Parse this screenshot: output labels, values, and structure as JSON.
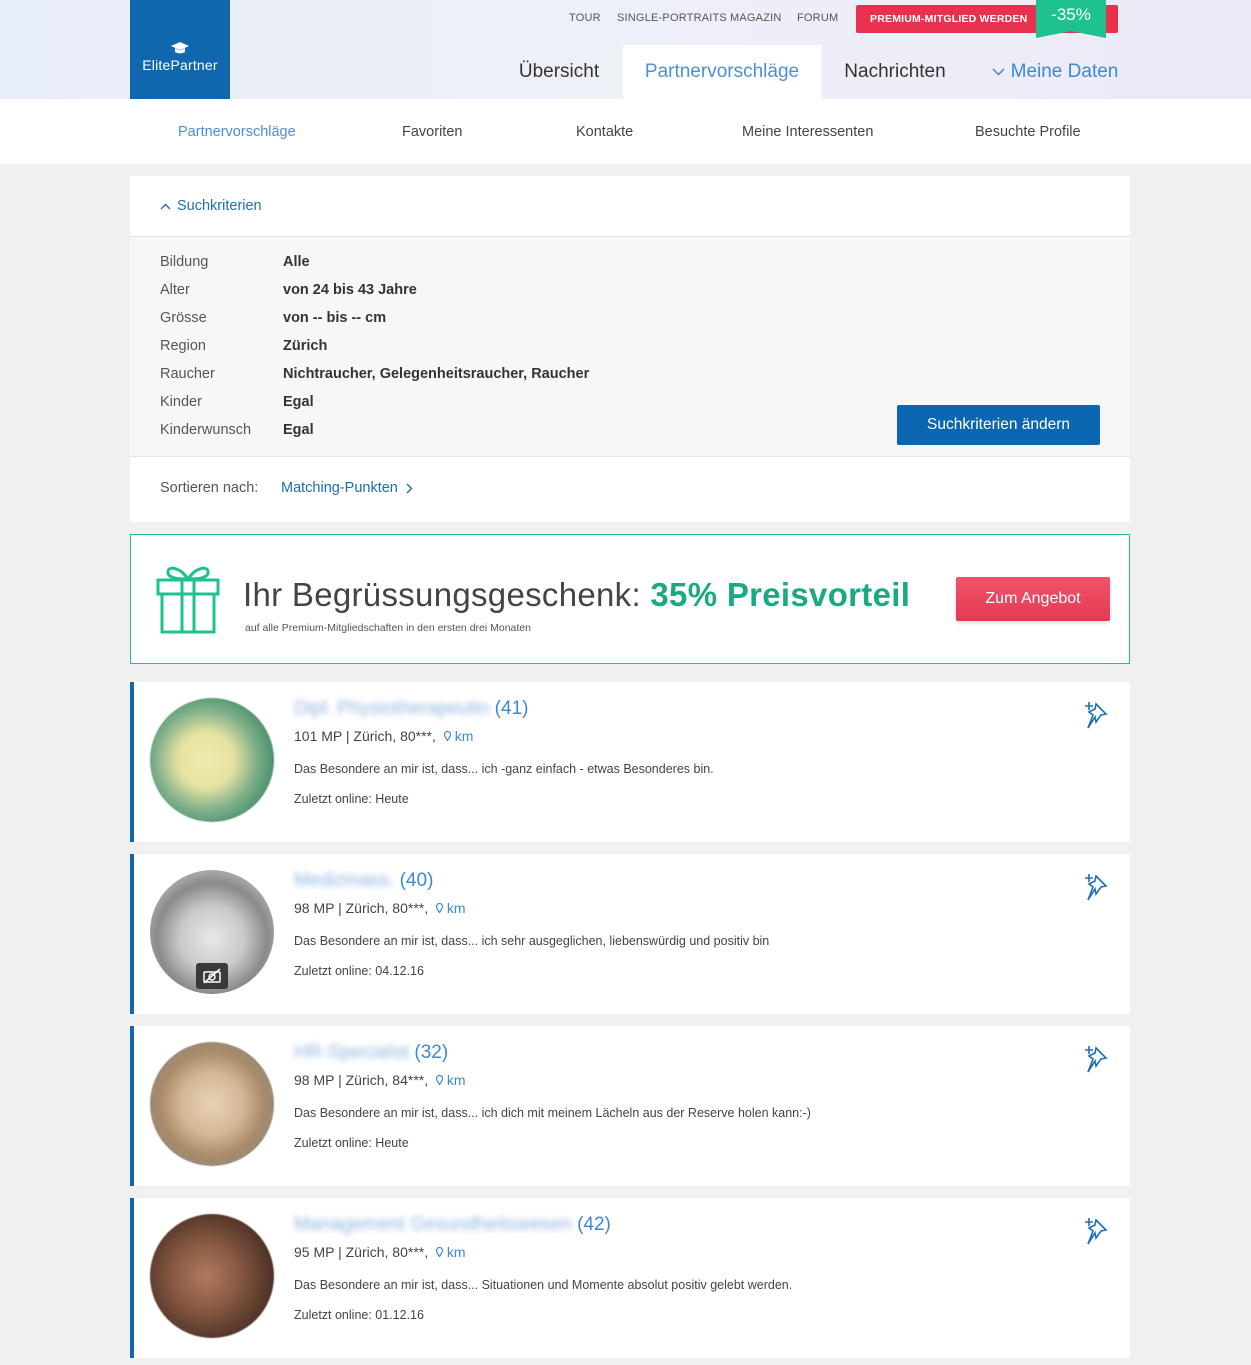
{
  "brand": {
    "name": "ElitePartner"
  },
  "topnav": {
    "tour": "TOUR",
    "portraits": "SINGLE-PORTRAITS",
    "magazin": "MAGAZIN",
    "forum": "FORUM"
  },
  "premium": {
    "label": "PREMIUM-MITGLIED WERDEN",
    "discount": "-35%"
  },
  "mainnav": {
    "uebersicht": "Übersicht",
    "partnervorschlaege": "Partnervorschläge",
    "nachrichten": "Nachrichten",
    "meine_daten": "Meine Daten"
  },
  "subnav": {
    "partnervorschlaege": "Partnervorschläge",
    "favoriten": "Favoriten",
    "kontakte": "Kontakte",
    "interessenten": "Meine Interessenten",
    "besuchte": "Besuchte Profile"
  },
  "criteria": {
    "toggle_label": "Suchkriterien",
    "rows": [
      {
        "label": "Bildung",
        "value": "Alle"
      },
      {
        "label": "Alter",
        "value": "von 24 bis 43 Jahre"
      },
      {
        "label": "Grösse",
        "value": "von -- bis -- cm"
      },
      {
        "label": "Region",
        "value": "Zürich"
      },
      {
        "label": "Raucher",
        "value": "Nichtraucher, Gelegenheitsraucher, Raucher"
      },
      {
        "label": "Kinder",
        "value": "Egal"
      },
      {
        "label": "Kinderwunsch",
        "value": "Egal"
      }
    ],
    "change_button": "Suchkriterien ändern",
    "sort_label": "Sortieren nach:",
    "sort_value": "Matching-Punkten"
  },
  "promo": {
    "title": "Ihr Begrüssungsgeschenk:",
    "highlight": "35% Preisvorteil",
    "subtitle": "auf alle Premium-Mitgliedschaften in den ersten drei Monaten",
    "button": "Zum Angebot"
  },
  "profiles": [
    {
      "title": "Dipl. Physiotherapeutin",
      "age": "(41)",
      "mp": "101 MP | Zürich, 80***,",
      "km": "km",
      "desc": "Das Besondere an mir ist, dass... ich -ganz einfach - etwas Besonderes bin.",
      "online": "Zuletzt online: Heute"
    },
    {
      "title": "Medizinass.",
      "age": "(40)",
      "mp": "98 MP | Zürich, 80***,",
      "km": "km",
      "desc": "Das Besondere an mir ist, dass... ich sehr ausgeglichen, liebenswürdig und positiv bin",
      "online": "Zuletzt online: 04.12.16"
    },
    {
      "title": "HR-Specialist",
      "age": "(32)",
      "mp": "98 MP | Zürich, 84***,",
      "km": "km",
      "desc": "Das Besondere an mir ist, dass... ich dich mit meinem Lächeln aus der Reserve holen kann:-)",
      "online": "Zuletzt online: Heute"
    },
    {
      "title": "Management Gesundheitswesen",
      "age": "(42)",
      "mp": "95 MP | Zürich, 80***,",
      "km": "km",
      "desc": "Das Besondere an mir ist, dass... Situationen und Momente absolut positiv gelebt werden.",
      "online": "Zuletzt online: 01.12.16"
    }
  ],
  "colors": {
    "brand_blue": "#1067ad",
    "accent_green": "#1ec28f",
    "premium_red": "#e8304f",
    "link_blue": "#3a8ad6"
  },
  "icons": [
    "graduation-cap-icon",
    "chevron-up-icon",
    "chevron-right-icon",
    "chevron-down-icon",
    "gift-icon",
    "pin-add-icon",
    "location-icon",
    "no-photo-icon"
  ]
}
